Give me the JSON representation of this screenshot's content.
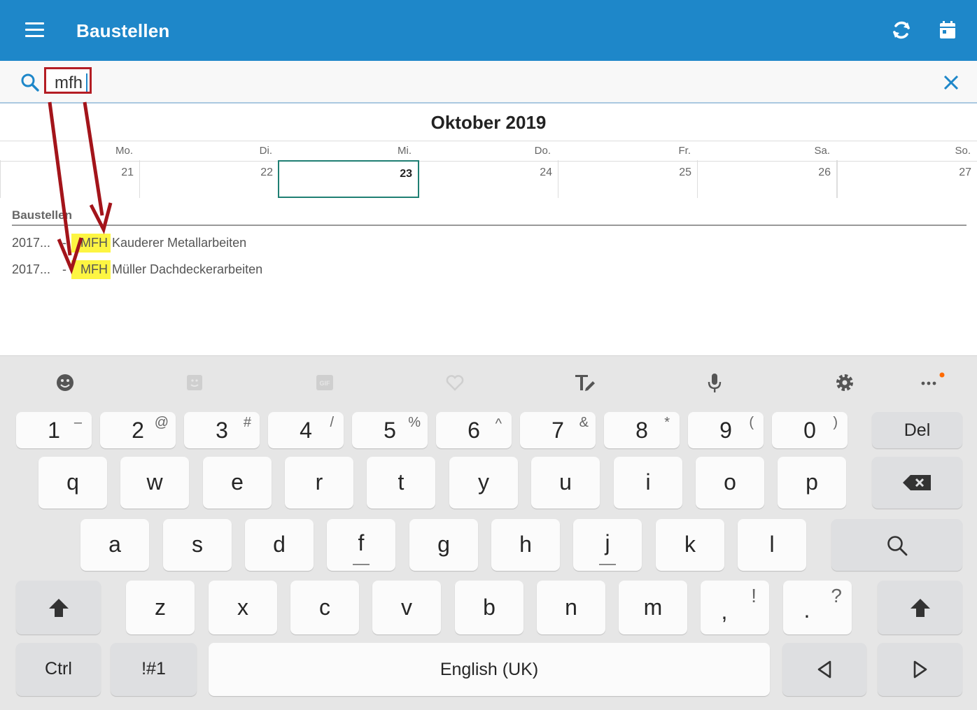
{
  "app": {
    "title": "Baustellen",
    "menu_icon": "hamburger-menu-icon",
    "refresh_icon": "refresh-icon",
    "calendar_icon": "calendar-icon",
    "brand_color": "#1e87c9"
  },
  "search": {
    "value": "mfh",
    "search_icon": "search-icon",
    "clear_icon": "close-icon",
    "highlight_color": "#b41d24"
  },
  "calendar": {
    "month": "Oktober 2019",
    "weekdays": [
      "Mo.",
      "Di.",
      "Mi.",
      "Do.",
      "Fr.",
      "Sa.",
      "So."
    ],
    "days": [
      "21",
      "22",
      "23",
      "24",
      "25",
      "26",
      "27"
    ],
    "selected_day": "23"
  },
  "list": {
    "header": "Baustellen",
    "items": [
      {
        "date": "2017...",
        "sep": "-",
        "match": "MFH",
        "rest": "Kauderer Metallarbeiten"
      },
      {
        "date": "2017...",
        "sep": "-",
        "match": "MFH",
        "rest": "Müller Dachdeckerarbeiten"
      }
    ],
    "match_color": "#fdf542"
  },
  "keyboard": {
    "toolbar": [
      "emoji-icon",
      "sticker-icon",
      "gif-icon",
      "heart-icon",
      "text-edit-icon",
      "microphone-icon",
      "settings-icon",
      "more-icon"
    ],
    "numbers": [
      {
        "main": "1",
        "sec": "–"
      },
      {
        "main": "2",
        "sec": "@"
      },
      {
        "main": "3",
        "sec": "#"
      },
      {
        "main": "4",
        "sec": "/"
      },
      {
        "main": "5",
        "sec": "%"
      },
      {
        "main": "6",
        "sec": "^"
      },
      {
        "main": "7",
        "sec": "&"
      },
      {
        "main": "8",
        "sec": "*"
      },
      {
        "main": "9",
        "sec": "("
      },
      {
        "main": "0",
        "sec": ")"
      }
    ],
    "del_label": "Del",
    "row1": [
      "q",
      "w",
      "e",
      "r",
      "t",
      "y",
      "u",
      "i",
      "o",
      "p"
    ],
    "row2": [
      "a",
      "s",
      "d",
      "f",
      "g",
      "h",
      "j",
      "k",
      "l"
    ],
    "row3": [
      "z",
      "x",
      "c",
      "v",
      "b",
      "n",
      "m"
    ],
    "comma": {
      "main": ",",
      "sec": "!"
    },
    "period": {
      "main": ".",
      "sec": "?"
    },
    "ctrl_label": "Ctrl",
    "symbols_label": "!#1",
    "space_label": "English (UK)",
    "backspace_icon": "backspace-icon",
    "search_key_icon": "search-icon",
    "shift_icon": "shift-icon",
    "left_icon": "arrow-left-icon",
    "right_icon": "arrow-right-icon",
    "notification_color": "#ff6a00"
  }
}
